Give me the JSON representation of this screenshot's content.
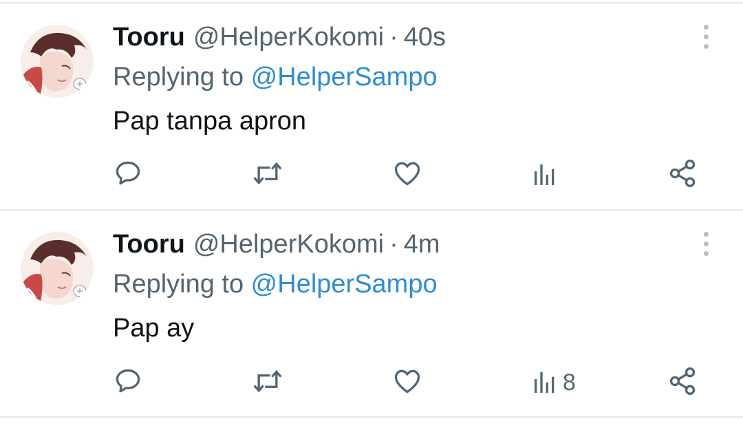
{
  "tweets": [
    {
      "display_name": "Tooru",
      "handle": "@HelperKokomi",
      "separator": "·",
      "time": "40s",
      "replying_prefix": "Replying to ",
      "replying_to": "@HelperSampo",
      "text": "Pap tanpa apron",
      "views_count": ""
    },
    {
      "display_name": "Tooru",
      "handle": "@HelperKokomi",
      "separator": "·",
      "time": "4m",
      "replying_prefix": "Replying to ",
      "replying_to": "@HelperSampo",
      "text": "Pap ay",
      "views_count": "8"
    }
  ],
  "icons": {
    "reply": "speech-bubble-icon",
    "retweet": "retweet-arrows-icon",
    "like": "heart-icon",
    "views": "bar-chart-icon",
    "share": "share-nodes-icon",
    "more": "vertical-dots-icon"
  },
  "colors": {
    "text": "#0f1419",
    "secondary": "#536471",
    "mention": "#2f8dd1",
    "divider": "#e6e8ea"
  }
}
